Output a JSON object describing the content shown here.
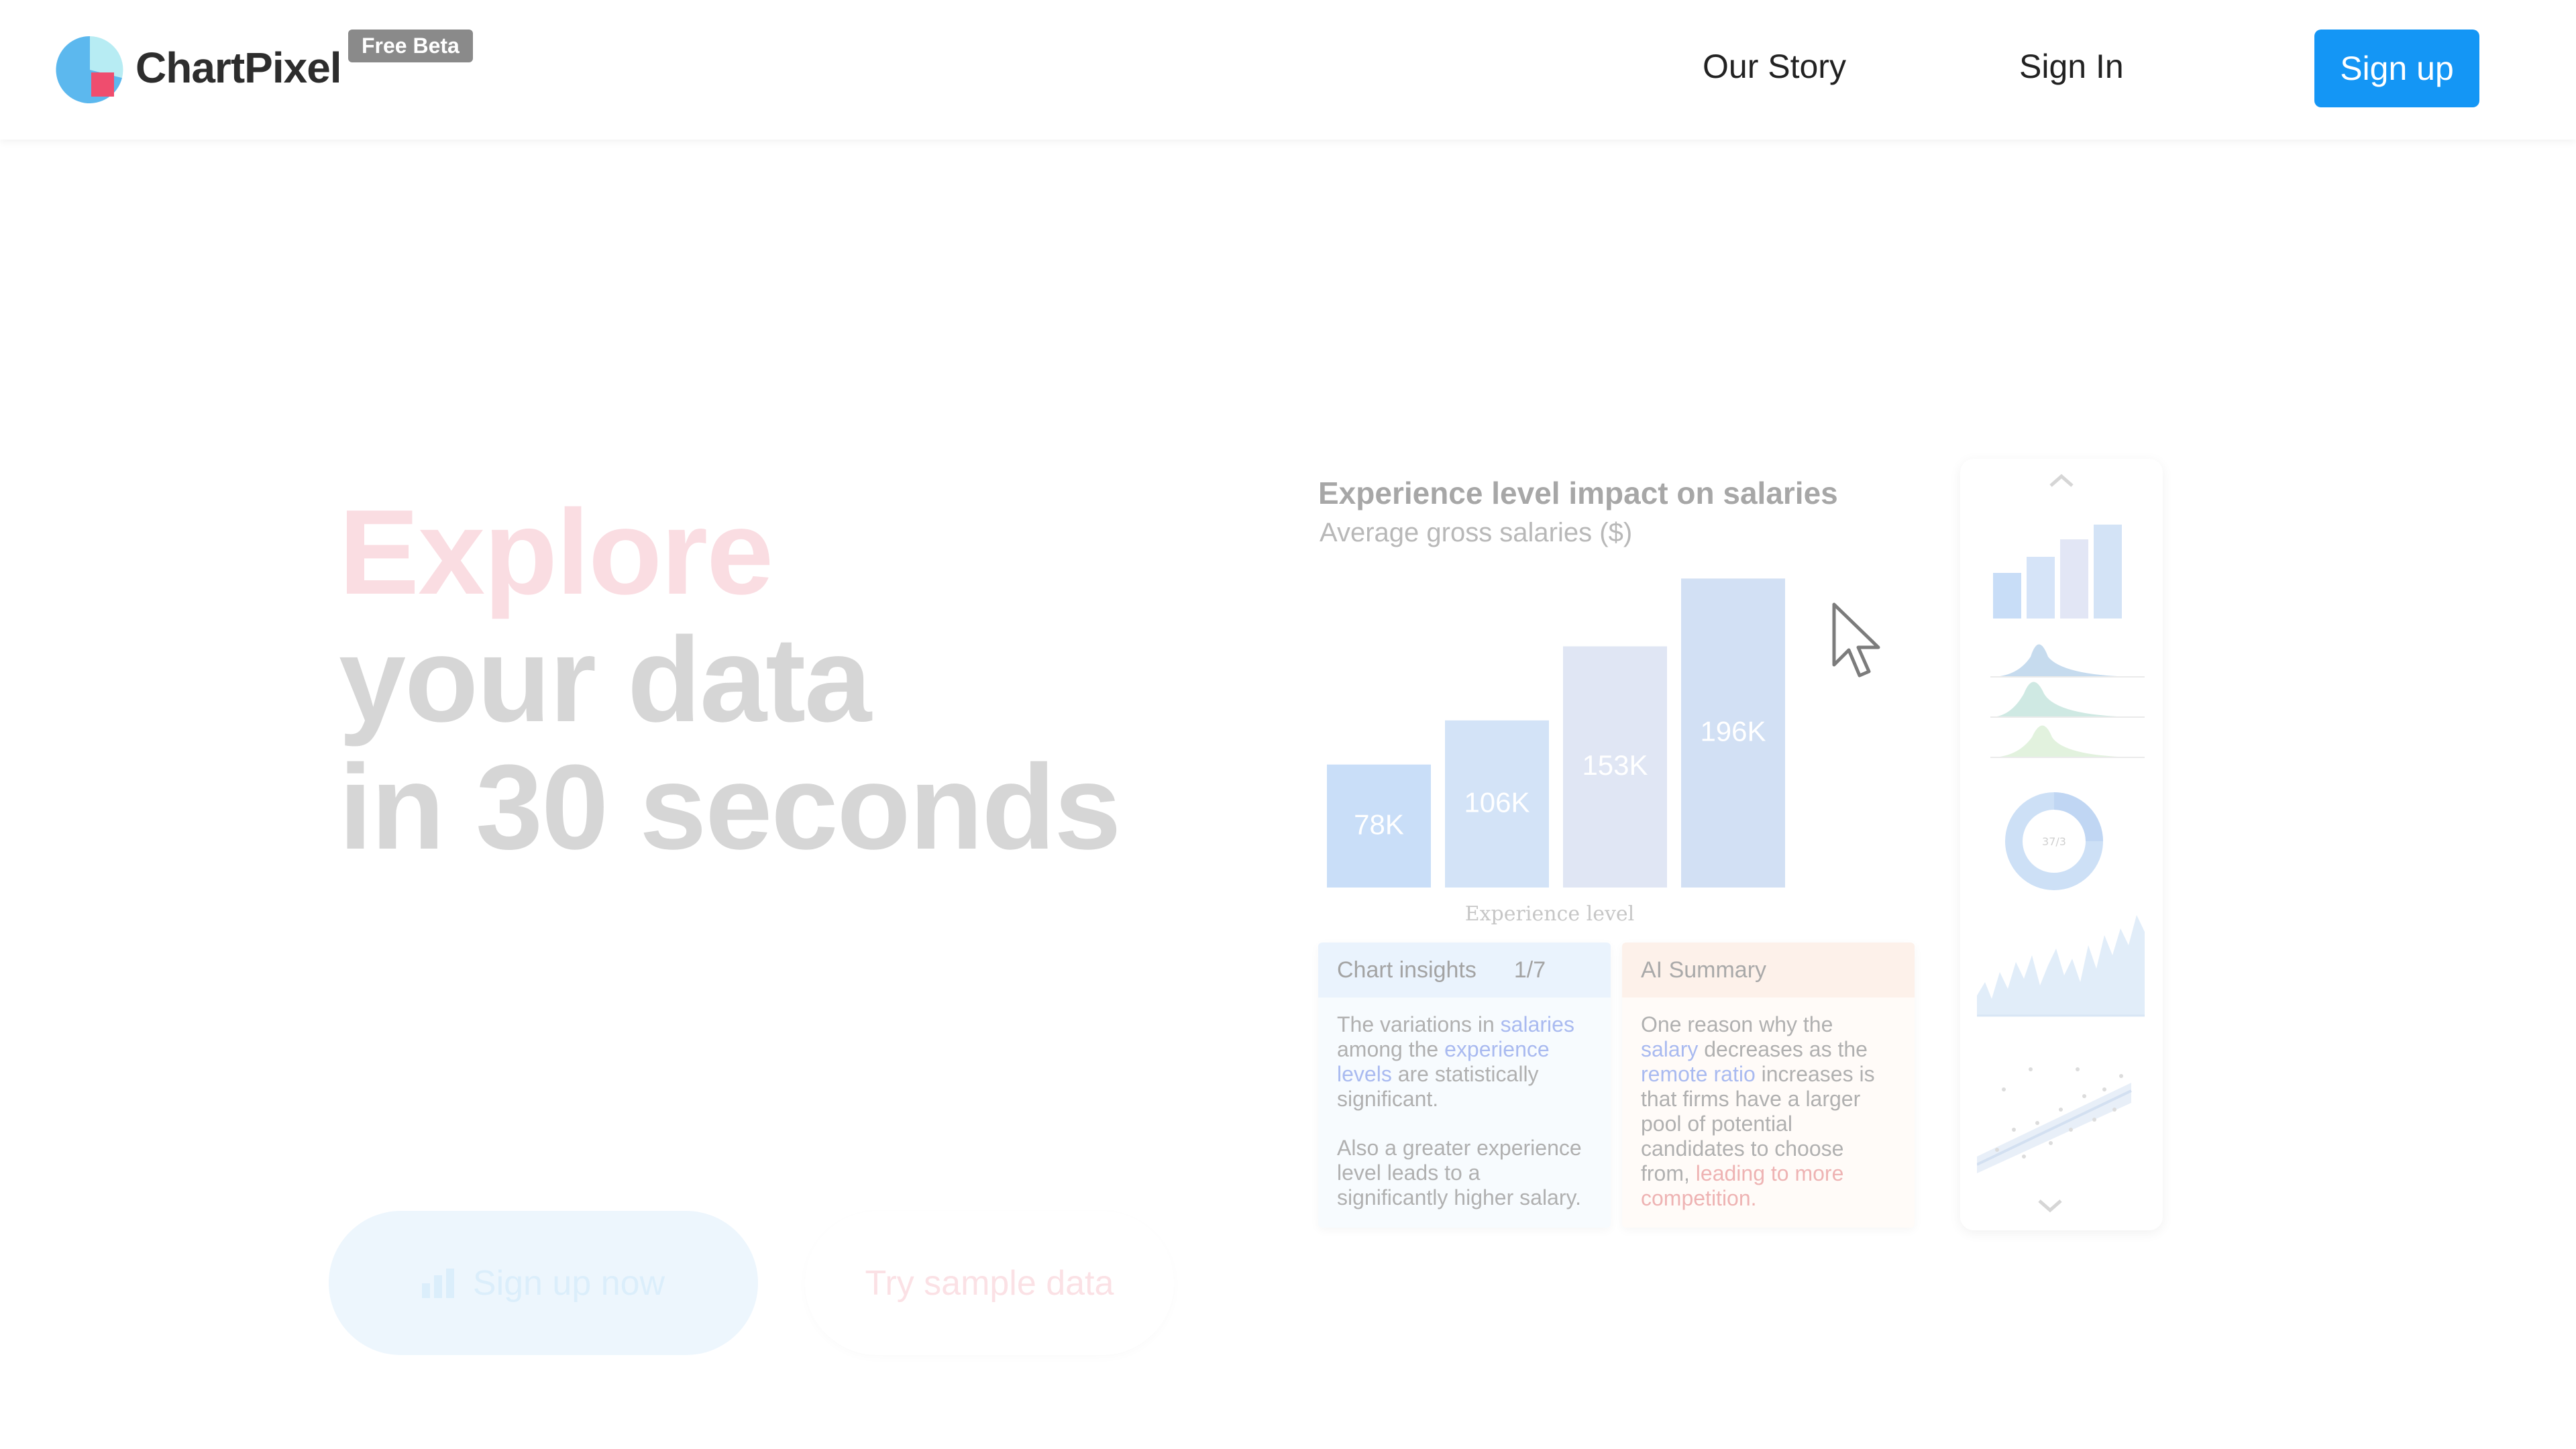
{
  "header": {
    "brand": "ChartPixel",
    "badge": "Free Beta",
    "nav": [
      "Our Story",
      "Sign In"
    ],
    "signup_label": "Sign up"
  },
  "hero": {
    "line1": "Explore",
    "line2": "your data",
    "line3": "in 30 seconds",
    "cta_primary": "Sign up now",
    "cta_secondary": "Try sample data"
  },
  "preview": {
    "insights_title": "Chart insights",
    "insights_page": "1/7",
    "insights_p1": [
      "The variations in ",
      "salaries",
      " among the ",
      "experience levels",
      " are statistically significant."
    ],
    "insights_p2": "Also a greater experience level leads to a significantly higher salary.",
    "summary_title": "AI Summary",
    "summary_text": [
      "One reason why the ",
      "salary",
      " decreases as the ",
      "remote ratio",
      " increases is that firms have a larger pool of potential candidates to choose from, ",
      "leading to more competition."
    ],
    "donut_label": "37/3"
  },
  "chart_data": {
    "type": "bar",
    "title": "Experience level impact on salaries",
    "subtitle": "Average gross salaries ($)",
    "xlabel": "Experience level",
    "ylabel": "",
    "categories": [
      "",
      "",
      "",
      ""
    ],
    "values": [
      78,
      106,
      153,
      196
    ],
    "labels": [
      "78K",
      "106K",
      "153K",
      "196K"
    ],
    "ylim": [
      0,
      200
    ],
    "colors": [
      "#c9def8",
      "#d3e3f7",
      "#e0e6f4",
      "#d2e0f4"
    ]
  },
  "colors": {
    "accent": "#1496f5",
    "hero_pink": "#fadde2",
    "hero_gray": "#d6d6d6"
  }
}
